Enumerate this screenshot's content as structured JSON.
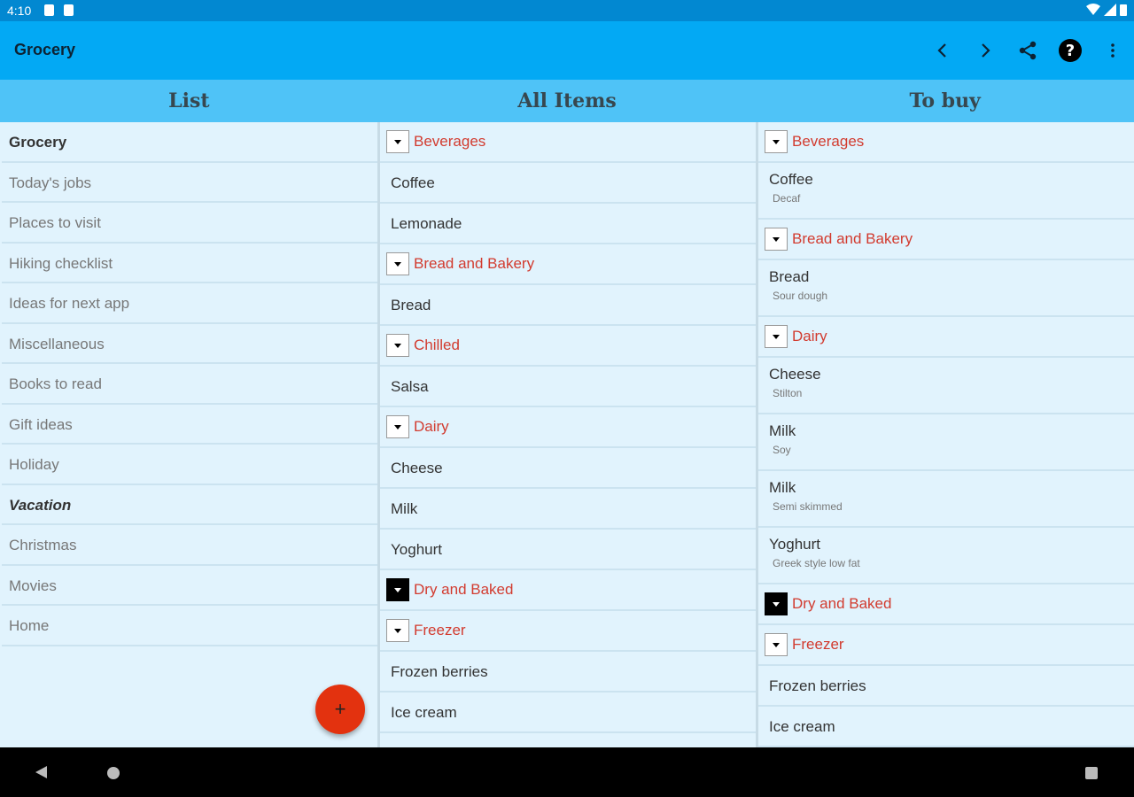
{
  "status": {
    "time": "4:10"
  },
  "appbar": {
    "title": "Grocery"
  },
  "headers": {
    "list": "List",
    "all_items": "All Items",
    "to_buy": "To buy"
  },
  "lists": [
    "Grocery",
    "Today's jobs",
    "Places to visit",
    "Hiking checklist",
    "Ideas for next app",
    "Miscellaneous",
    "Books to read",
    "Gift ideas",
    "Holiday",
    "Vacation",
    "Christmas",
    "Movies",
    "Home"
  ],
  "all_items": {
    "cats": [
      "Beverages",
      "Bread and Bakery",
      "Chilled",
      "Dairy",
      "Dry and Baked",
      "Freezer"
    ],
    "items": [
      "Coffee",
      "Lemonade",
      "Bread",
      "Salsa",
      "Cheese",
      "Milk",
      "Yoghurt",
      "Frozen berries",
      "Ice cream"
    ]
  },
  "to_buy": {
    "cats": [
      "Beverages",
      "Bread and Bakery",
      "Dairy",
      "Dry and Baked",
      "Freezer"
    ],
    "items": [
      {
        "name": "Coffee",
        "note": "Decaf"
      },
      {
        "name": "Bread",
        "note": "Sour dough"
      },
      {
        "name": "Cheese",
        "note": "Stilton"
      },
      {
        "name": "Milk",
        "note": "Soy"
      },
      {
        "name": "Milk",
        "note": "Semi skimmed"
      },
      {
        "name": "Yoghurt",
        "note": "Greek style low fat"
      },
      {
        "name": "Frozen berries",
        "note": ""
      },
      {
        "name": "Ice cream",
        "note": ""
      }
    ]
  },
  "fab": {
    "label": "+"
  },
  "colors": {
    "appbar": "#03a9f4",
    "header": "#4fc3f7",
    "category": "#d23b2f",
    "fab": "#e3320f",
    "background": "#e1f3fd"
  },
  "icons": [
    "chevron-left-icon",
    "chevron-right-icon",
    "share-icon",
    "help-icon",
    "more-vert-icon",
    "wifi-icon",
    "signal-icon",
    "battery-icon"
  ]
}
